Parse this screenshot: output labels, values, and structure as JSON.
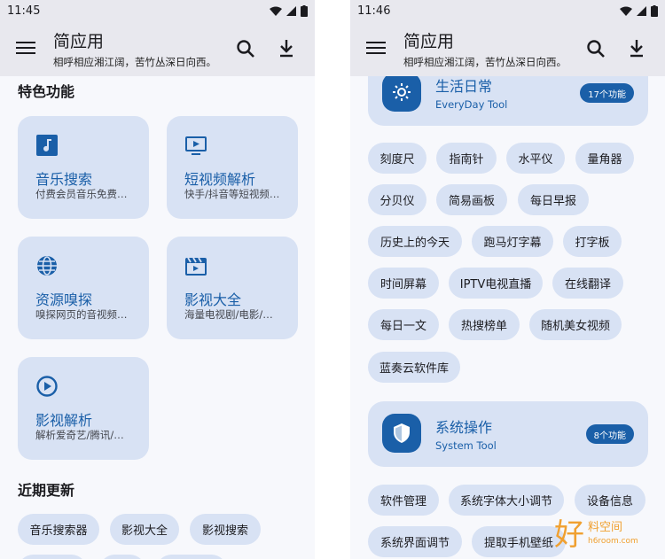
{
  "colors": {
    "accent": "#1a5fa8",
    "card_bg": "#d8e2f4",
    "appbar_bg": "#e8e8ee",
    "page_bg": "#f7f8fc"
  },
  "left": {
    "status": {
      "time": "11:45"
    },
    "appbar": {
      "title": "简应用",
      "subtitle": "相呼相应湘江阔，苦竹丛深日向西。",
      "icons": [
        "menu-icon",
        "search-icon",
        "download-icon"
      ]
    },
    "featured": {
      "title": "特色功能",
      "cards": [
        {
          "title": "音乐搜索",
          "desc": "付费会员音乐免费…",
          "icon": "music-icon"
        },
        {
          "title": "短视频解析",
          "desc": "快手/抖音等短视频…",
          "icon": "tv-icon"
        },
        {
          "title": "资源嗅探",
          "desc": "嗅探网页的音视频…",
          "icon": "globe-icon"
        },
        {
          "title": "影视大全",
          "desc": "海量电视剧/电影/…",
          "icon": "clapper-icon"
        },
        {
          "title": "影视解析",
          "desc": "解析爱奇艺/腾讯/…",
          "icon": "play-circle-icon"
        }
      ]
    },
    "recent": {
      "title": "近期更新",
      "chips": [
        "音乐搜索器",
        "影视大全",
        "影视搜索"
      ]
    }
  },
  "right": {
    "status": {
      "time": "11:46"
    },
    "appbar": {
      "title": "简应用",
      "subtitle": "相呼相应湘江阔，苦竹丛深日向西。"
    },
    "categories": [
      {
        "title": "生活日常",
        "subtitle": "EveryDay Tool",
        "badge": "17个功能",
        "icon": "sun-icon",
        "chips": [
          "刻度尺",
          "指南针",
          "水平仪",
          "量角器",
          "分贝仪",
          "简易画板",
          "每日早报",
          "历史上的今天",
          "跑马灯字幕",
          "打字板",
          "时间屏幕",
          "IPTV电视直播",
          "在线翻译",
          "每日一文",
          "热搜榜单",
          "随机美女视频",
          "蓝奏云软件库"
        ]
      },
      {
        "title": "系统操作",
        "subtitle": "System Tool",
        "badge": "8个功能",
        "icon": "shield-icon",
        "chips": [
          "软件管理",
          "系统字体大小调节",
          "设备信息",
          "系统界面调节",
          "提取手机壁纸"
        ]
      }
    ]
  },
  "watermark": {
    "main": "好",
    "side": "料空间",
    "url": "h6room.com"
  }
}
